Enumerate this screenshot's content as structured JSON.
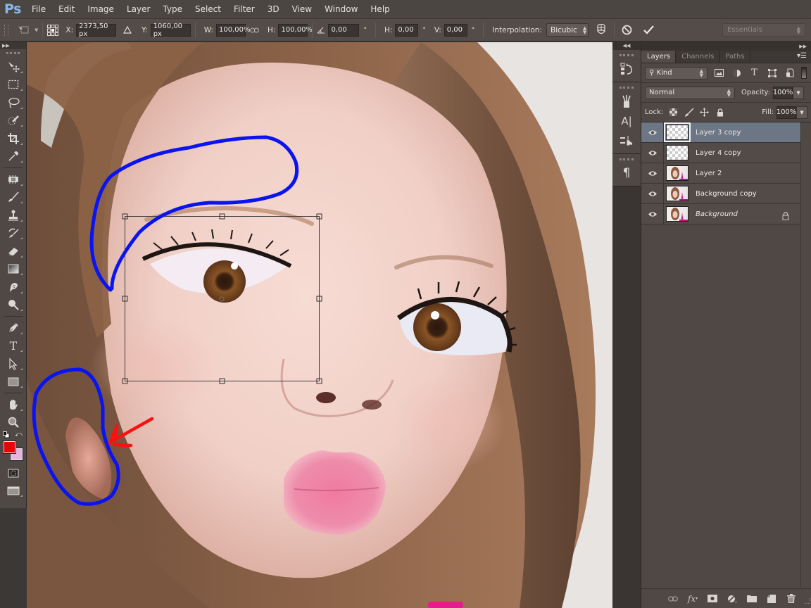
{
  "app": {
    "logo": "Ps",
    "name": "Adobe Photoshop"
  },
  "menu": [
    "File",
    "Edit",
    "Image",
    "Layer",
    "Type",
    "Select",
    "Filter",
    "3D",
    "View",
    "Window",
    "Help"
  ],
  "options": {
    "x_label": "X:",
    "x_value": "2373,50 px",
    "y_label": "Y:",
    "y_value": "1060,00 px",
    "w_label": "W:",
    "w_value": "100,00%",
    "h_label": "H:",
    "h_value": "100,00%",
    "angle_value": "0,00",
    "angle_unit": "°",
    "hskew_label": "H:",
    "hskew_value": "0,00",
    "hskew_unit": "°",
    "vskew_label": "V:",
    "vskew_value": "0,00",
    "vskew_unit": "°",
    "interpolation_label": "Interpolation:",
    "interpolation_value": "Bicubic",
    "workspace": "Essentials"
  },
  "tools": [
    "move-tool",
    "marquee-tool",
    "lasso-tool",
    "quick-selection-tool",
    "crop-tool",
    "eyedropper-tool",
    "healing-brush-tool",
    "brush-tool",
    "clone-stamp-tool",
    "history-brush-tool",
    "eraser-tool",
    "gradient-tool",
    "smudge-tool",
    "dodge-tool",
    "pen-tool",
    "type-tool",
    "path-selection-tool",
    "rectangle-tool",
    "hand-tool",
    "zoom-tool"
  ],
  "colors": {
    "foreground": "#ee0000",
    "background": "#e6b4dc"
  },
  "annotations": {
    "outline_color": "#0a14f0",
    "arrow_color": "#ff1010"
  },
  "dock": {
    "type_symbol": "A|",
    "paragraph_symbol": "¶"
  },
  "layers_panel": {
    "tabs": [
      {
        "label": "Layers",
        "active": true
      },
      {
        "label": "Channels",
        "active": false
      },
      {
        "label": "Paths",
        "active": false
      }
    ],
    "filter_kind": "Kind",
    "blend_mode": "Normal",
    "opacity_label": "Opacity:",
    "opacity_value": "100%",
    "lock_label": "Lock:",
    "fill_label": "Fill:",
    "fill_value": "100%",
    "layers": [
      {
        "name": "Layer 3 copy",
        "visible": true,
        "selected": true,
        "thumb": "transparent",
        "locked": false,
        "italic": false
      },
      {
        "name": "Layer 4 copy",
        "visible": true,
        "selected": false,
        "thumb": "transparent",
        "locked": false,
        "italic": false
      },
      {
        "name": "Layer 2",
        "visible": true,
        "selected": false,
        "thumb": "photo",
        "locked": false,
        "italic": false
      },
      {
        "name": "Background copy",
        "visible": true,
        "selected": false,
        "thumb": "photo",
        "locked": false,
        "italic": false
      },
      {
        "name": "Background",
        "visible": true,
        "selected": false,
        "thumb": "photo",
        "locked": true,
        "italic": true
      }
    ],
    "footer_icons": [
      "link-layers-icon",
      "fx-icon",
      "layer-mask-icon",
      "adjustment-layer-icon",
      "new-group-icon",
      "new-layer-icon",
      "delete-layer-icon"
    ],
    "fx_label": "fx"
  }
}
